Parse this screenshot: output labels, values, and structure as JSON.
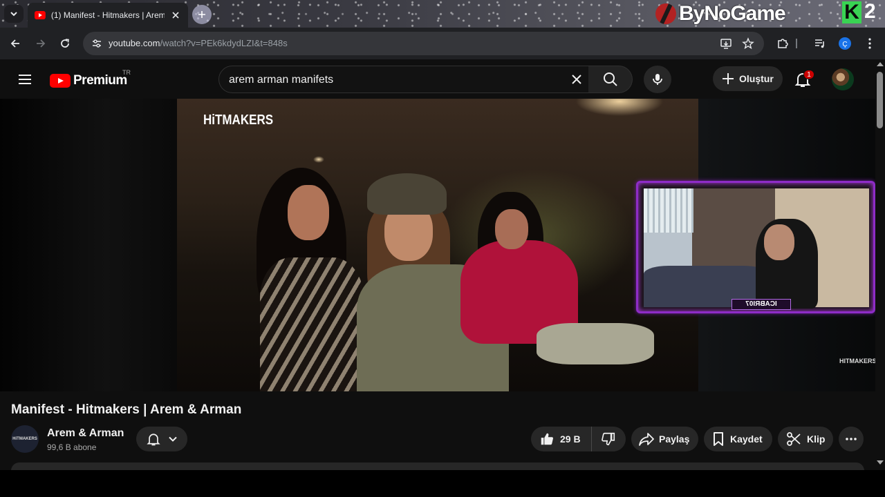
{
  "browser": {
    "tab_title": "(1) Manifest - Hitmakers | Arem",
    "url_domain": "youtube.com",
    "url_path": "/watch?v=PEk6kdydLZI&t=848s"
  },
  "overlay": {
    "brand_text": "ByNoGame",
    "k_logo": "K",
    "k_number": "2"
  },
  "masthead": {
    "logo_text": "Premium",
    "country_code": "TR",
    "search_value": "arem arman manifets",
    "create_label": "Oluştur",
    "notification_count": "1"
  },
  "player": {
    "channel_overlay": "HiTMAKERS",
    "watermark": "HITMAKERS",
    "webcam_label": "ICABRI07"
  },
  "video": {
    "title": "Manifest - Hitmakers | Arem & Arman",
    "channel_name": "Arem & Arman",
    "channel_avatar_text": "HiTMAKERS",
    "subscribers": "99,6 B abone",
    "likes": "29 B",
    "share_label": "Paylaş",
    "save_label": "Kaydet",
    "clip_label": "Klip"
  },
  "colors": {
    "youtube_red": "#ff0000",
    "background": "#0f0f0f",
    "pill": "#272727",
    "webcam_frame": "#8e2cc7"
  }
}
